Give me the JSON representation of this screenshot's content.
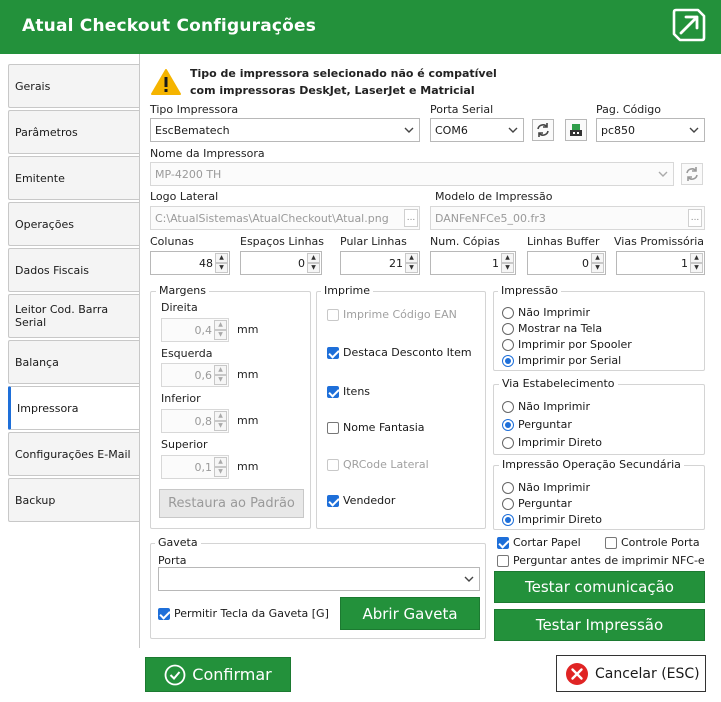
{
  "window": {
    "title": "Atual Checkout Configurações",
    "logo_icon": "arrow-up-right-box-icon",
    "brand_color": "#23913b"
  },
  "tabs": [
    {
      "label": "Gerais"
    },
    {
      "label": "Parâmetros"
    },
    {
      "label": "Emitente"
    },
    {
      "label": "Operações"
    },
    {
      "label": "Dados Fiscais"
    },
    {
      "label": "Leitor Cod. Barra Serial"
    },
    {
      "label": "Balança"
    },
    {
      "label": "Impressora"
    },
    {
      "label": "Configurações E-Mail"
    },
    {
      "label": "Backup"
    }
  ],
  "active_tab": "Impressora",
  "warning": {
    "icon": "warning-icon",
    "line1": "Tipo de impressora selecionado não é compatível",
    "line2": "com impressoras DeskJet, LaserJet e Matricial"
  },
  "printer": {
    "tipo_label": "Tipo Impressora",
    "tipo_value": "EscBematech",
    "porta_label": "Porta Serial",
    "porta_value": "COM6",
    "pag_label": "Pag. Código",
    "pag_value": "pc850",
    "nome_label": "Nome da Impressora",
    "nome_value": "MP-4200 TH",
    "logo_label": "Logo Lateral",
    "logo_value": "C:\\AtualSistemas\\AtualCheckout\\Atual.png",
    "modelo_label": "Modelo de Impressão",
    "modelo_value": "DANFeNFCe5_00.fr3",
    "browse_label": "..."
  },
  "numbers": [
    {
      "label": "Colunas",
      "value": "48"
    },
    {
      "label": "Espaços Linhas",
      "value": "0"
    },
    {
      "label": "Pular Linhas",
      "value": "21"
    },
    {
      "label": "Num. Cópias",
      "value": "1"
    },
    {
      "label": "Linhas Buffer",
      "value": "0"
    },
    {
      "label": "Vias Promissória",
      "value": "1"
    }
  ],
  "margens": {
    "title": "Margens",
    "unit": "mm",
    "items": [
      {
        "label": "Direita",
        "value": "0,4"
      },
      {
        "label": "Esquerda",
        "value": "0,6"
      },
      {
        "label": "Inferior",
        "value": "0,8"
      },
      {
        "label": "Superior",
        "value": "0,1"
      }
    ],
    "restore_label": "Restaura ao Padrão"
  },
  "imprime": {
    "title": "Imprime",
    "items": [
      {
        "label": "Imprime Código EAN",
        "checked": false,
        "enabled": false
      },
      {
        "label": "Destaca Desconto Item",
        "checked": true,
        "enabled": true
      },
      {
        "label": "Itens",
        "checked": true,
        "enabled": true
      },
      {
        "label": "Nome Fantasia",
        "checked": false,
        "enabled": true
      },
      {
        "label": "QRCode Lateral",
        "checked": false,
        "enabled": false
      },
      {
        "label": "Vendedor",
        "checked": true,
        "enabled": true
      }
    ]
  },
  "impressao": {
    "title": "Impressão",
    "options": [
      "Não Imprimir",
      "Mostrar na Tela",
      "Imprimir por Spooler",
      "Imprimir por Serial"
    ],
    "selected": "Imprimir por Serial"
  },
  "via": {
    "title": "Via Estabelecimento",
    "options": [
      "Não Imprimir",
      "Perguntar",
      "Imprimir Direto"
    ],
    "selected": "Perguntar"
  },
  "secundaria": {
    "title": "Impressão Operação Secundária",
    "options": [
      "Não Imprimir",
      "Perguntar",
      "Imprimir Direto"
    ],
    "selected": "Imprimir Direto"
  },
  "extras": {
    "cortar": "Cortar Papel",
    "controle": "Controle Porta",
    "perguntar": "Perguntar antes de imprimir NFC-e"
  },
  "gaveta": {
    "title": "Gaveta",
    "porta_label": "Porta",
    "porta_value": "",
    "permitir": "Permitir Tecla da Gaveta [G]",
    "abrir": "Abrir Gaveta"
  },
  "actions": {
    "testar_com": "Testar comunicação",
    "testar_imp": "Testar Impressão",
    "confirmar": "Confirmar",
    "cancelar": "Cancelar (ESC)"
  }
}
